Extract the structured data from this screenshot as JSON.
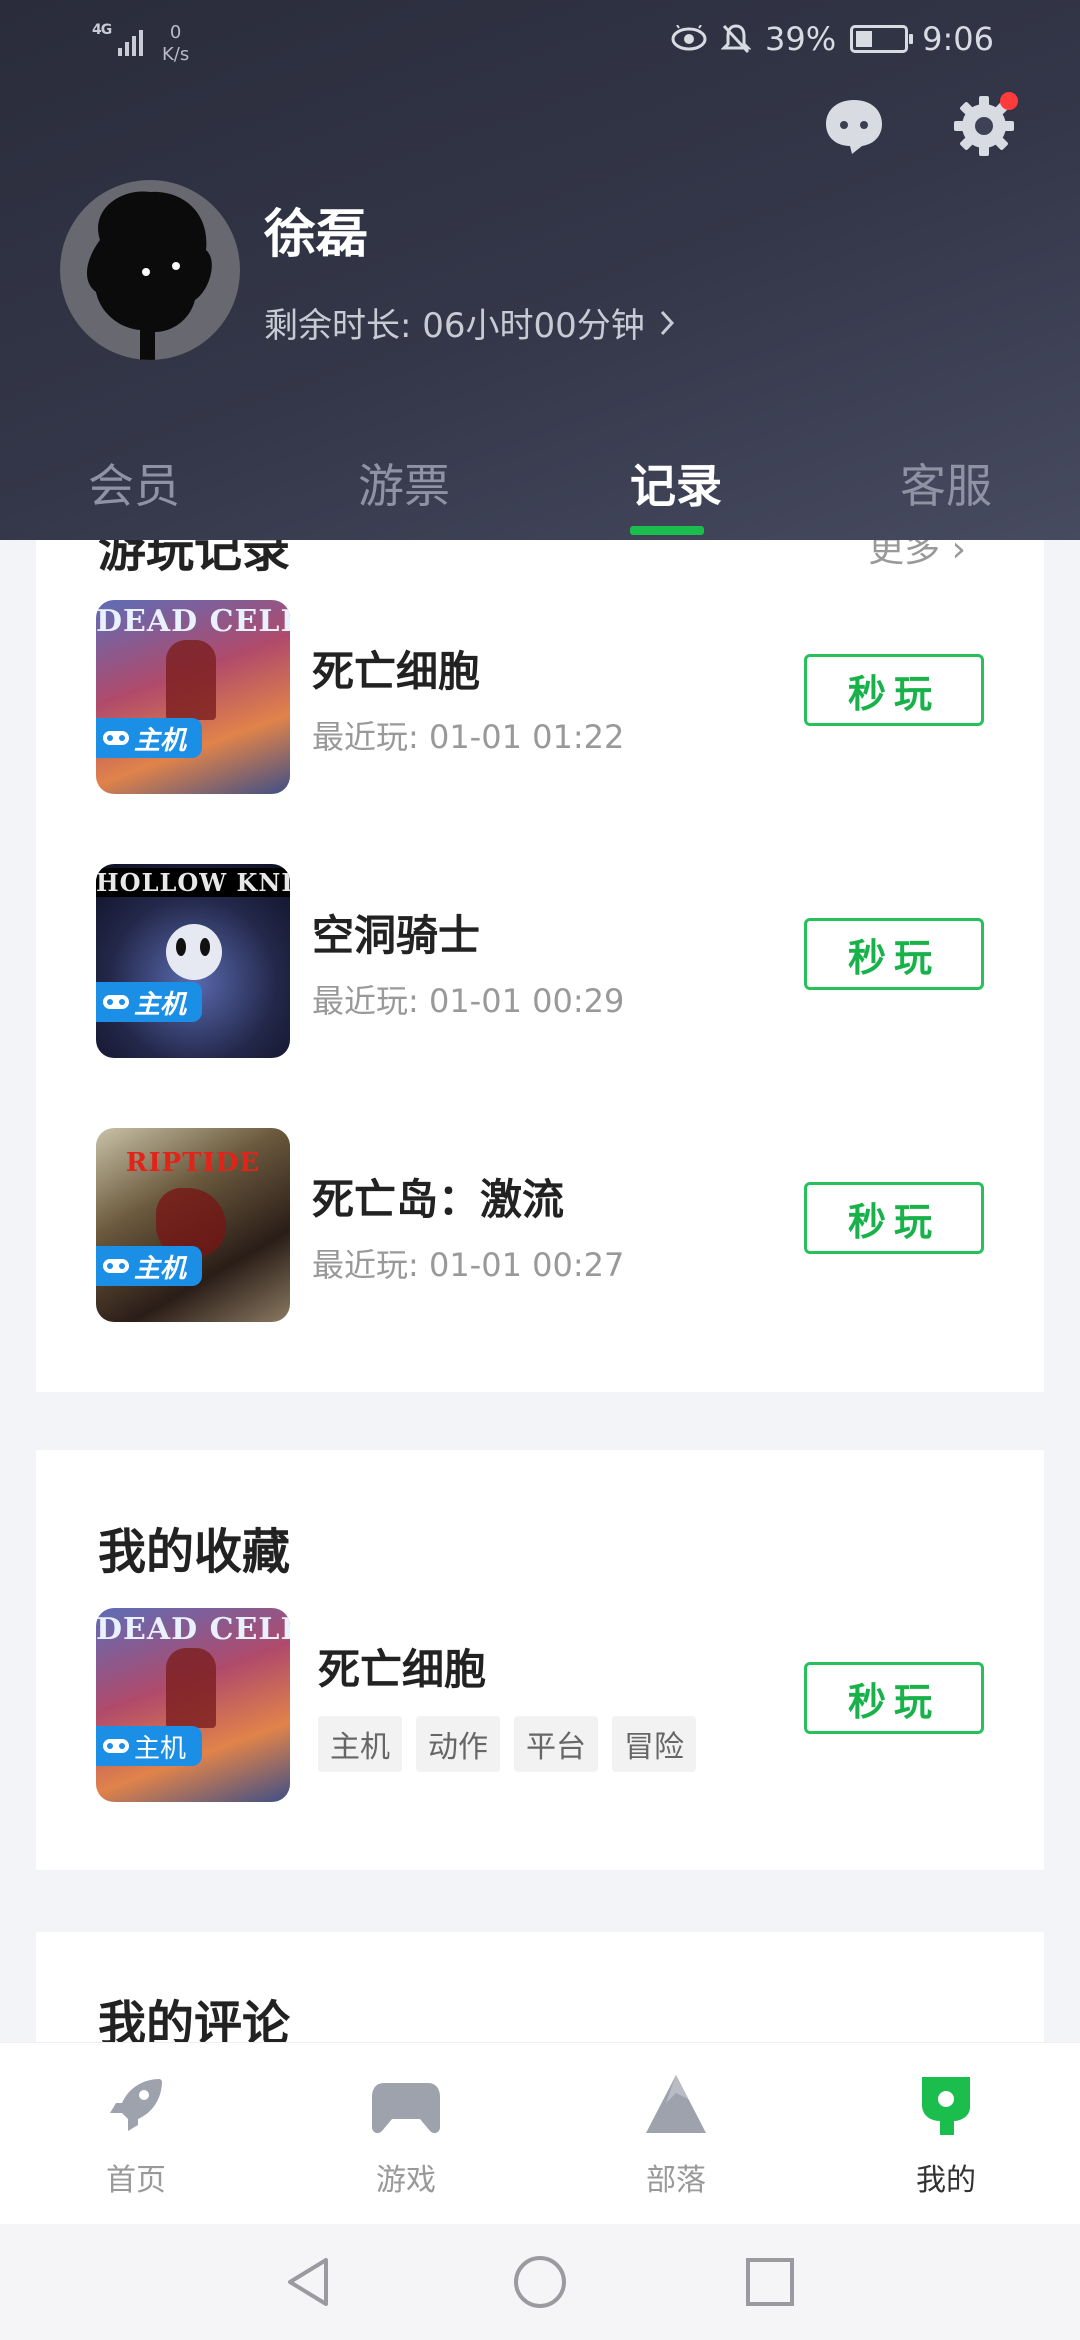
{
  "status_bar": {
    "network": "4G",
    "net_speed_value": "0",
    "net_speed_unit": "K/s",
    "battery": "39%",
    "time": "9:06"
  },
  "profile": {
    "username": "徐磊",
    "remaining_time": "剩余时长: 06小时00分钟"
  },
  "tabs": [
    {
      "label": "会员",
      "active": false
    },
    {
      "label": "游票",
      "active": false
    },
    {
      "label": "记录",
      "active": true
    },
    {
      "label": "客服",
      "active": false
    }
  ],
  "history": {
    "title": "游玩记录",
    "more_label": "更多 ›",
    "games": [
      {
        "name": "死亡细胞",
        "last_played": "最近玩: 01-01 01:22",
        "cover_text": "DEAD CELLS",
        "badge": "主机",
        "play_label": "秒玩"
      },
      {
        "name": "空洞骑士",
        "last_played": "最近玩: 01-01 00:29",
        "cover_text": "HOLLOW KNIGHT",
        "badge": "主机",
        "play_label": "秒玩"
      },
      {
        "name": "死亡岛：激流",
        "last_played": "最近玩: 01-01 00:27",
        "cover_text": "RIPTIDE",
        "badge": "主机",
        "play_label": "秒玩"
      }
    ]
  },
  "favorites": {
    "title": "我的收藏",
    "game": {
      "name": "死亡细胞",
      "cover_text": "DEAD CELLS",
      "badge": "主机",
      "tags": [
        "主机",
        "动作",
        "平台",
        "冒险"
      ],
      "play_label": "秒玩"
    }
  },
  "comments": {
    "title": "我的评论"
  },
  "bottom_nav": [
    {
      "label": "首页",
      "icon": "rocket-icon",
      "active": false
    },
    {
      "label": "游戏",
      "icon": "gamepad-icon",
      "active": false
    },
    {
      "label": "部落",
      "icon": "mountain-icon",
      "active": false
    },
    {
      "label": "我的",
      "icon": "profile-icon",
      "active": true
    }
  ],
  "colors": {
    "accent": "#1bbd4d",
    "header_bg": "#343749",
    "badge_blue": "#1b8fe6",
    "notification_dot": "#ff3b3b"
  }
}
